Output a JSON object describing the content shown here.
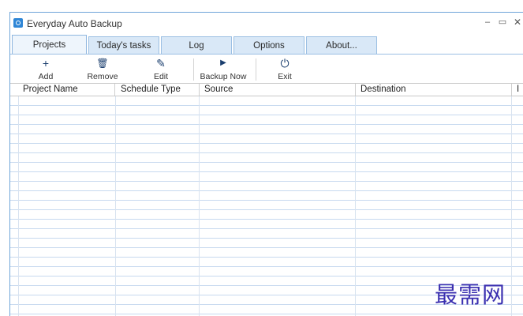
{
  "window": {
    "title": "Everyday Auto Backup",
    "minimize": "–",
    "maximize": "▭",
    "close": "✕"
  },
  "tabs": [
    {
      "label": "Projects",
      "active": true
    },
    {
      "label": "Today's tasks",
      "active": false
    },
    {
      "label": "Log",
      "active": false
    },
    {
      "label": "Options",
      "active": false
    },
    {
      "label": "About...",
      "active": false
    }
  ],
  "toolbar": {
    "add": {
      "label": "Add",
      "icon": "+"
    },
    "remove": {
      "label": "Remove",
      "icon": "🗑"
    },
    "edit": {
      "label": "Edit",
      "icon": "✎"
    },
    "backup_now": {
      "label": "Backup Now",
      "icon": "▶"
    },
    "exit": {
      "label": "Exit",
      "icon": "⏻"
    }
  },
  "columns": [
    "Project Name",
    "Schedule Type",
    "Source",
    "Destination",
    "I"
  ],
  "watermark": "最需网",
  "colors": {
    "tab_bg": "#d9e8f7",
    "tab_border": "#9bbfe3",
    "grid_line": "#c7d9ef",
    "watermark": "#3a2fb0"
  }
}
